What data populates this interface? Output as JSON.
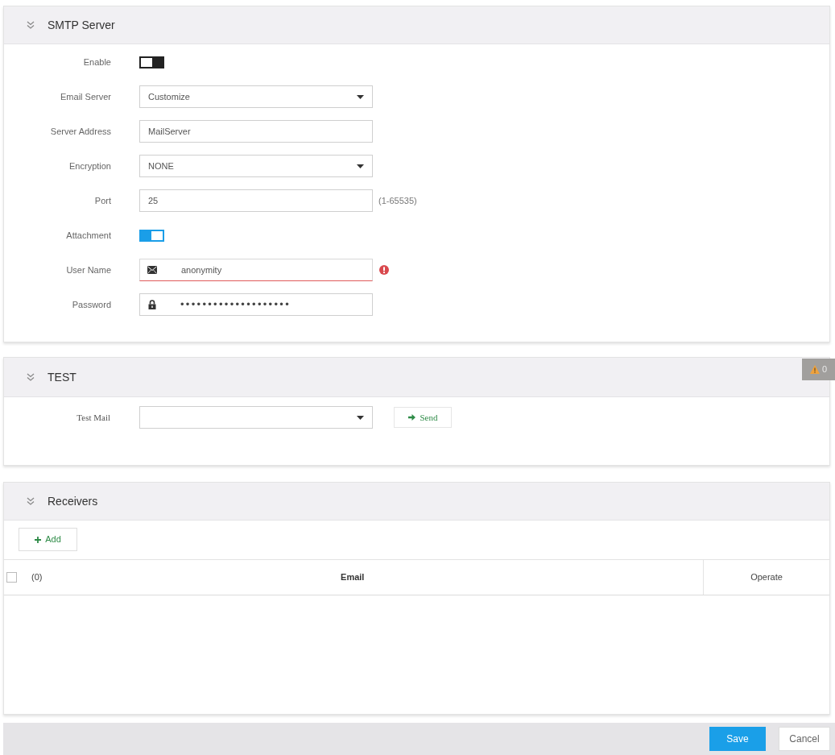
{
  "smtp_server": {
    "title": "SMTP Server",
    "fields": [
      {
        "kind": "toggle",
        "label": "Enable",
        "on": false
      },
      {
        "kind": "select",
        "label": "Email Server",
        "value": "Customize",
        "error": false
      },
      {
        "kind": "text",
        "label": "Server Address",
        "value": "MailServer",
        "error": false
      },
      {
        "kind": "select",
        "label": "Encryption",
        "value": "NONE",
        "error": false
      },
      {
        "kind": "text",
        "label": "Port",
        "value": "25",
        "hint": "(1-65535)",
        "error": false
      },
      {
        "kind": "toggle",
        "label": "Attachment",
        "on": true
      },
      {
        "kind": "user",
        "label": "User Name",
        "value": "anonymity",
        "error": true
      },
      {
        "kind": "password",
        "label": "Password",
        "value": "••••••••••••••••••••",
        "error": false
      }
    ]
  },
  "test": {
    "title": "TEST",
    "warning_count": "0",
    "test_mail": {
      "label": "Test Mail"
    },
    "send_button": "Send"
  },
  "receivers": {
    "title": "Receivers",
    "add_button": "Add",
    "table": {
      "select_all": {
        "checked": false
      },
      "count": "(0)",
      "columns": [
        "Email",
        "Operate"
      ]
    }
  },
  "footer": {
    "buttons": [
      {
        "label": "Save",
        "kind": "primary"
      },
      {
        "label": "Cancel",
        "kind": "secondary"
      }
    ]
  }
}
